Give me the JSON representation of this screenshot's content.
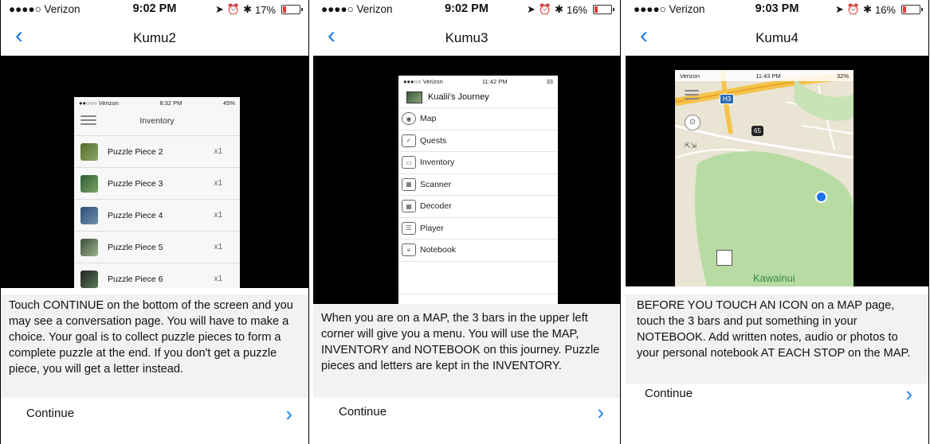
{
  "panels": [
    {
      "status": {
        "carrier": "●●●●○ Verizon",
        "time": "9:02 PM",
        "battery_text": "17%",
        "battery_level": 0.17
      },
      "nav": {
        "title": "Kumu2"
      },
      "inner": {
        "status_left": "●●○○○ Verizon",
        "status_time": "8:32 PM",
        "status_right": "45%",
        "header_title": "Inventory",
        "items": [
          {
            "name": "Puzzle Piece 2",
            "qty": "x1"
          },
          {
            "name": "Puzzle Piece 3",
            "qty": "x1"
          },
          {
            "name": "Puzzle Piece 4",
            "qty": "x1"
          },
          {
            "name": "Puzzle Piece 5",
            "qty": "x1"
          },
          {
            "name": "Puzzle Piece 6",
            "qty": "x1"
          }
        ]
      },
      "body_text": "Touch CONTINUE on the bottom of the screen and you may see a conversation page. You will have to make a choice. Your goal is to collect puzzle pieces to form a complete puzzle at the end. If you don't get a puzzle piece, you will get a letter instead.",
      "continue_label": "Continue"
    },
    {
      "status": {
        "carrier": "●●●●○ Verizon",
        "time": "9:02 PM",
        "battery_text": "16%",
        "battery_level": 0.16
      },
      "nav": {
        "title": "Kumu3"
      },
      "inner": {
        "status_left": "●●●○○ Verizon",
        "status_time": "11:42 PM",
        "status_right": "33",
        "header_title": "Kualii's Journey",
        "menu": [
          "Map",
          "Quests",
          "Inventory",
          "Scanner",
          "Decoder",
          "Player",
          "Notebook"
        ]
      },
      "body_text": "When you are on a MAP, the 3 bars in the upper left corner will give you a menu. You will use the MAP, INVENTORY and NOTEBOOK on this journey. Puzzle pieces and letters are kept in the INVENTORY.",
      "continue_label": "Continue"
    },
    {
      "status": {
        "carrier": "●●●●○ Verizon",
        "time": "9:03 PM",
        "battery_text": "16%",
        "battery_level": 0.16
      },
      "nav": {
        "title": "Kumu4"
      },
      "inner": {
        "status_left": "Verizon",
        "status_time": "11:43 PM",
        "status_right": "32%",
        "shield_h3": "H3",
        "shield_65": "65",
        "map_label": "Kawainui"
      },
      "body_text": "BEFORE YOU TOUCH AN ICON on a MAP page, touch the 3 bars and put something in your NOTEBOOK. Add written notes, audio or photos to your personal notebook AT EACH STOP on the MAP.",
      "continue_label": "Continue"
    }
  ],
  "icons": {
    "back": "‹",
    "next": "›"
  },
  "colors": {
    "accent": "#1c7ef3",
    "battery_low": "#e53935"
  }
}
